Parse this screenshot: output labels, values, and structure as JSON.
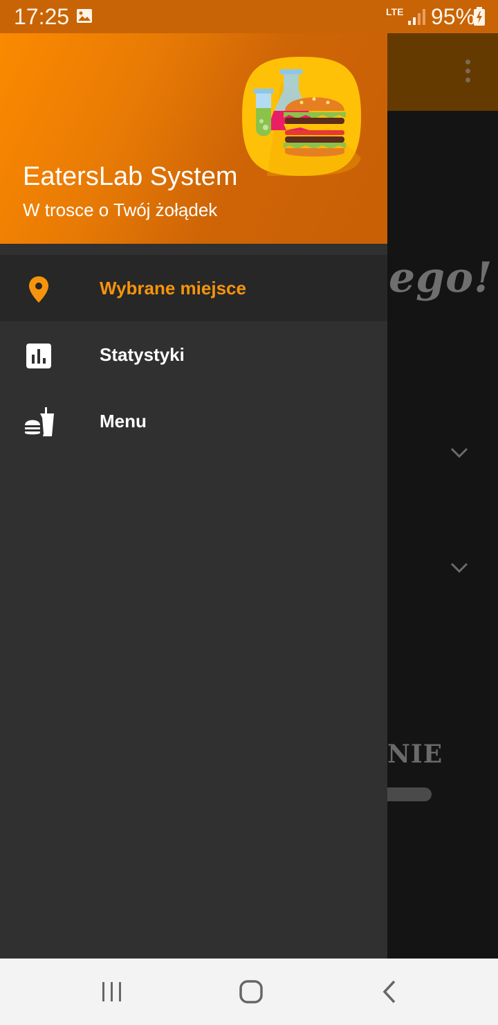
{
  "status_bar": {
    "time": "17:25",
    "network": "LTE",
    "battery": "95%",
    "icons": [
      "gallery-icon",
      "signal-icon",
      "battery-charging-icon"
    ]
  },
  "drawer": {
    "header": {
      "title": "EatersLab System",
      "subtitle": "W trosce o Twój żołądek",
      "logo": "burger-lab-logo"
    },
    "items": [
      {
        "label": "Wybrane miejsce",
        "icon": "location-pin-icon",
        "active": true
      },
      {
        "label": "Statystyki",
        "icon": "bar-chart-icon",
        "active": false
      },
      {
        "label": "Menu",
        "icon": "fastfood-icon",
        "active": false
      }
    ]
  },
  "background_screen": {
    "heading_fragment": "ego!",
    "section_fragment": "NIE"
  },
  "colors": {
    "accent": "#f7940c",
    "status_bar": "#c86405",
    "drawer_background": "#303030",
    "active_item_background": "#272727"
  }
}
